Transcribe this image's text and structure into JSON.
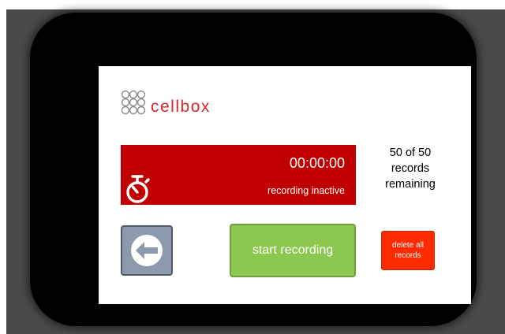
{
  "logo": {
    "text": "cellbox",
    "mark_icon": "dot-grid-logo-icon",
    "color": "#d4262c"
  },
  "timer": {
    "time": "00:00:00",
    "status": "recording inactive",
    "icon": "stopwatch-icon",
    "panel_color": "#c00000"
  },
  "records": {
    "line1": "50 of 50",
    "line2": "records",
    "line3": "remaining"
  },
  "buttons": {
    "back_icon": "back-arrow-icon",
    "back_color": "#8c9aae",
    "start_label": "start recording",
    "start_color": "#8cc84f",
    "delete_line1": "delete all",
    "delete_line2": "records",
    "delete_color": "#ff2a00"
  }
}
